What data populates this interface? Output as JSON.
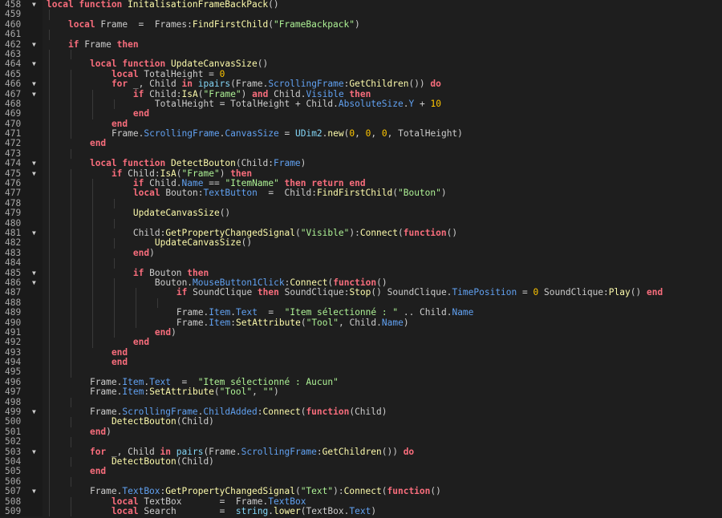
{
  "editor": {
    "language": "lua",
    "colors": {
      "background": "#1e1e1e",
      "gutter": "#1a1a1a",
      "line_number": "#a9a9a9",
      "keyword": "#f86d7c",
      "function": "#fdfbac",
      "property": "#61a1f1",
      "string": "#adf195",
      "number": "#ffc600",
      "builtin": "#84d6f7",
      "text": "#cccccc"
    },
    "lines": [
      {
        "n": "458",
        "fold": true,
        "indent": 0,
        "tokens": [
          [
            "kw",
            "local function "
          ],
          [
            "fn",
            "InitalisationFrameBackPack"
          ],
          [
            "op",
            "()"
          ]
        ]
      },
      {
        "n": "459",
        "fold": false,
        "indent": 1,
        "tokens": []
      },
      {
        "n": "460",
        "fold": false,
        "indent": 1,
        "tokens": [
          [
            "kw",
            "local "
          ],
          [
            "op",
            "Frame  =  Frames:"
          ],
          [
            "fn",
            "FindFirstChild"
          ],
          [
            "op",
            "("
          ],
          [
            "str",
            "\"FrameBackpack\""
          ],
          [
            "op",
            ")"
          ]
        ]
      },
      {
        "n": "461",
        "fold": false,
        "indent": 1,
        "tokens": []
      },
      {
        "n": "462",
        "fold": true,
        "indent": 1,
        "tokens": [
          [
            "kw",
            "if "
          ],
          [
            "op",
            "Frame "
          ],
          [
            "kw",
            "then"
          ]
        ]
      },
      {
        "n": "463",
        "fold": false,
        "indent": 2,
        "tokens": []
      },
      {
        "n": "464",
        "fold": true,
        "indent": 2,
        "tokens": [
          [
            "kw",
            "local function "
          ],
          [
            "fn",
            "UpdateCanvasSize"
          ],
          [
            "op",
            "()"
          ]
        ]
      },
      {
        "n": "465",
        "fold": false,
        "indent": 3,
        "tokens": [
          [
            "kw",
            "local "
          ],
          [
            "op",
            "TotalHeight = "
          ],
          [
            "num",
            "0"
          ]
        ]
      },
      {
        "n": "466",
        "fold": true,
        "indent": 3,
        "tokens": [
          [
            "kw",
            "for "
          ],
          [
            "op",
            "_, Child "
          ],
          [
            "kw",
            "in "
          ],
          [
            "builtin",
            "ipairs"
          ],
          [
            "op",
            "(Frame."
          ],
          [
            "prop",
            "ScrollingFrame"
          ],
          [
            "op",
            ":"
          ],
          [
            "fn",
            "GetChildren"
          ],
          [
            "op",
            "()) "
          ],
          [
            "kw",
            "do"
          ]
        ]
      },
      {
        "n": "467",
        "fold": true,
        "indent": 4,
        "tokens": [
          [
            "kw",
            "if "
          ],
          [
            "op",
            "Child:"
          ],
          [
            "fn",
            "IsA"
          ],
          [
            "op",
            "("
          ],
          [
            "str",
            "\"Frame\""
          ],
          [
            "op",
            ") "
          ],
          [
            "kw",
            "and "
          ],
          [
            "op",
            "Child."
          ],
          [
            "prop",
            "Visible"
          ],
          [
            "kw",
            " then"
          ]
        ]
      },
      {
        "n": "468",
        "fold": false,
        "indent": 5,
        "tokens": [
          [
            "op",
            "TotalHeight = TotalHeight + Child."
          ],
          [
            "prop",
            "AbsoluteSize"
          ],
          [
            "op",
            "."
          ],
          [
            "prop",
            "Y"
          ],
          [
            "op",
            " + "
          ],
          [
            "num",
            "10"
          ]
        ]
      },
      {
        "n": "469",
        "fold": false,
        "indent": 4,
        "tokens": [
          [
            "kw",
            "end"
          ]
        ]
      },
      {
        "n": "470",
        "fold": false,
        "indent": 3,
        "tokens": [
          [
            "kw",
            "end"
          ]
        ]
      },
      {
        "n": "471",
        "fold": false,
        "indent": 3,
        "tokens": [
          [
            "op",
            "Frame."
          ],
          [
            "prop",
            "ScrollingFrame"
          ],
          [
            "op",
            "."
          ],
          [
            "prop",
            "CanvasSize"
          ],
          [
            "op",
            " = "
          ],
          [
            "builtin",
            "UDim2"
          ],
          [
            "op",
            "."
          ],
          [
            "fn",
            "new"
          ],
          [
            "op",
            "("
          ],
          [
            "num",
            "0"
          ],
          [
            "op",
            ", "
          ],
          [
            "num",
            "0"
          ],
          [
            "op",
            ", "
          ],
          [
            "num",
            "0"
          ],
          [
            "op",
            ", TotalHeight)"
          ]
        ]
      },
      {
        "n": "472",
        "fold": false,
        "indent": 2,
        "tokens": [
          [
            "kw",
            "end"
          ]
        ]
      },
      {
        "n": "473",
        "fold": false,
        "indent": 2,
        "tokens": []
      },
      {
        "n": "474",
        "fold": true,
        "indent": 2,
        "tokens": [
          [
            "kw",
            "local function "
          ],
          [
            "fn",
            "DetectBouton"
          ],
          [
            "op",
            "(Child:"
          ],
          [
            "prop",
            "Frame"
          ],
          [
            "op",
            ")"
          ]
        ]
      },
      {
        "n": "475",
        "fold": true,
        "indent": 3,
        "tokens": [
          [
            "kw",
            "if "
          ],
          [
            "op",
            "Child:"
          ],
          [
            "fn",
            "IsA"
          ],
          [
            "op",
            "("
          ],
          [
            "str",
            "\"Frame\""
          ],
          [
            "op",
            ") "
          ],
          [
            "kw",
            "then"
          ]
        ]
      },
      {
        "n": "476",
        "fold": false,
        "indent": 4,
        "tokens": [
          [
            "kw",
            "if "
          ],
          [
            "op",
            "Child."
          ],
          [
            "prop",
            "Name"
          ],
          [
            "op",
            " == "
          ],
          [
            "str",
            "\"ItemName\""
          ],
          [
            "kw",
            " then return end"
          ]
        ]
      },
      {
        "n": "477",
        "fold": false,
        "indent": 4,
        "tokens": [
          [
            "kw",
            "local "
          ],
          [
            "op",
            "Bouton:"
          ],
          [
            "prop",
            "TextButton"
          ],
          [
            "op",
            "  =  Child:"
          ],
          [
            "fn",
            "FindFirstChild"
          ],
          [
            "op",
            "("
          ],
          [
            "str",
            "\"Bouton\""
          ],
          [
            "op",
            ")"
          ]
        ]
      },
      {
        "n": "478",
        "fold": false,
        "indent": 4,
        "tokens": []
      },
      {
        "n": "479",
        "fold": false,
        "indent": 4,
        "tokens": [
          [
            "fn",
            "UpdateCanvasSize"
          ],
          [
            "op",
            "()"
          ]
        ]
      },
      {
        "n": "480",
        "fold": false,
        "indent": 4,
        "tokens": []
      },
      {
        "n": "481",
        "fold": true,
        "indent": 4,
        "tokens": [
          [
            "op",
            "Child:"
          ],
          [
            "fn",
            "GetPropertyChangedSignal"
          ],
          [
            "op",
            "("
          ],
          [
            "str",
            "\"Visible\""
          ],
          [
            "op",
            "):"
          ],
          [
            "fn",
            "Connect"
          ],
          [
            "op",
            "("
          ],
          [
            "kw",
            "function"
          ],
          [
            "op",
            "()"
          ]
        ]
      },
      {
        "n": "482",
        "fold": false,
        "indent": 5,
        "tokens": [
          [
            "fn",
            "UpdateCanvasSize"
          ],
          [
            "op",
            "()"
          ]
        ]
      },
      {
        "n": "483",
        "fold": false,
        "indent": 4,
        "tokens": [
          [
            "kw",
            "end"
          ],
          [
            "op",
            ")"
          ]
        ]
      },
      {
        "n": "484",
        "fold": false,
        "indent": 4,
        "tokens": []
      },
      {
        "n": "485",
        "fold": true,
        "indent": 4,
        "tokens": [
          [
            "kw",
            "if "
          ],
          [
            "op",
            "Bouton "
          ],
          [
            "kw",
            "then"
          ]
        ]
      },
      {
        "n": "486",
        "fold": true,
        "indent": 5,
        "tokens": [
          [
            "op",
            "Bouton."
          ],
          [
            "prop",
            "MouseButton1Click"
          ],
          [
            "op",
            ":"
          ],
          [
            "fn",
            "Connect"
          ],
          [
            "op",
            "("
          ],
          [
            "kw",
            "function"
          ],
          [
            "op",
            "()"
          ]
        ]
      },
      {
        "n": "487",
        "fold": false,
        "indent": 6,
        "tokens": [
          [
            "kw",
            "if "
          ],
          [
            "op",
            "SoundClique "
          ],
          [
            "kw",
            "then "
          ],
          [
            "op",
            "SoundClique:"
          ],
          [
            "fn",
            "Stop"
          ],
          [
            "op",
            "() SoundClique."
          ],
          [
            "prop",
            "TimePosition"
          ],
          [
            "op",
            " = "
          ],
          [
            "num",
            "0"
          ],
          [
            "op",
            " SoundClique:"
          ],
          [
            "fn",
            "Play"
          ],
          [
            "op",
            "() "
          ],
          [
            "kw",
            "end"
          ]
        ]
      },
      {
        "n": "488",
        "fold": false,
        "indent": 6,
        "tokens": []
      },
      {
        "n": "489",
        "fold": false,
        "indent": 6,
        "tokens": [
          [
            "op",
            "Frame."
          ],
          [
            "prop",
            "Item"
          ],
          [
            "op",
            "."
          ],
          [
            "prop",
            "Text"
          ],
          [
            "op",
            "  =  "
          ],
          [
            "str",
            "\"Item sélectionné : \""
          ],
          [
            "op",
            " .. Child."
          ],
          [
            "prop",
            "Name"
          ]
        ]
      },
      {
        "n": "490",
        "fold": false,
        "indent": 6,
        "tokens": [
          [
            "op",
            "Frame."
          ],
          [
            "prop",
            "Item"
          ],
          [
            "op",
            ":"
          ],
          [
            "fn",
            "SetAttribute"
          ],
          [
            "op",
            "("
          ],
          [
            "str",
            "\"Tool\""
          ],
          [
            "op",
            ", Child."
          ],
          [
            "prop",
            "Name"
          ],
          [
            "op",
            ")"
          ]
        ]
      },
      {
        "n": "491",
        "fold": false,
        "indent": 5,
        "tokens": [
          [
            "kw",
            "end"
          ],
          [
            "op",
            ")"
          ]
        ]
      },
      {
        "n": "492",
        "fold": false,
        "indent": 4,
        "tokens": [
          [
            "kw",
            "end"
          ]
        ]
      },
      {
        "n": "493",
        "fold": false,
        "indent": 3,
        "tokens": [
          [
            "kw",
            "end"
          ]
        ]
      },
      {
        "n": "494",
        "fold": false,
        "indent": 3,
        "tokens": [
          [
            "kw",
            "end"
          ]
        ]
      },
      {
        "n": "495",
        "fold": false,
        "indent": 2,
        "tokens": []
      },
      {
        "n": "496",
        "fold": false,
        "indent": 2,
        "tokens": [
          [
            "op",
            "Frame."
          ],
          [
            "prop",
            "Item"
          ],
          [
            "op",
            "."
          ],
          [
            "prop",
            "Text"
          ],
          [
            "op",
            "  =  "
          ],
          [
            "str",
            "\"Item sélectionné : Aucun\""
          ]
        ]
      },
      {
        "n": "497",
        "fold": false,
        "indent": 2,
        "tokens": [
          [
            "op",
            "Frame."
          ],
          [
            "prop",
            "Item"
          ],
          [
            "op",
            ":"
          ],
          [
            "fn",
            "SetAttribute"
          ],
          [
            "op",
            "("
          ],
          [
            "str",
            "\"Tool\""
          ],
          [
            "op",
            ", "
          ],
          [
            "str",
            "\"\""
          ],
          [
            "op",
            ")"
          ]
        ]
      },
      {
        "n": "498",
        "fold": false,
        "indent": 2,
        "tokens": []
      },
      {
        "n": "499",
        "fold": true,
        "indent": 2,
        "tokens": [
          [
            "op",
            "Frame."
          ],
          [
            "prop",
            "ScrollingFrame"
          ],
          [
            "op",
            "."
          ],
          [
            "prop",
            "ChildAdded"
          ],
          [
            "op",
            ":"
          ],
          [
            "fn",
            "Connect"
          ],
          [
            "op",
            "("
          ],
          [
            "kw",
            "function"
          ],
          [
            "op",
            "(Child)"
          ]
        ]
      },
      {
        "n": "500",
        "fold": false,
        "indent": 3,
        "tokens": [
          [
            "fn",
            "DetectBouton"
          ],
          [
            "op",
            "(Child)"
          ]
        ]
      },
      {
        "n": "501",
        "fold": false,
        "indent": 2,
        "tokens": [
          [
            "kw",
            "end"
          ],
          [
            "op",
            ")"
          ]
        ]
      },
      {
        "n": "502",
        "fold": false,
        "indent": 2,
        "tokens": []
      },
      {
        "n": "503",
        "fold": true,
        "indent": 2,
        "tokens": [
          [
            "kw",
            "for "
          ],
          [
            "op",
            "_, Child "
          ],
          [
            "kw",
            "in "
          ],
          [
            "builtin",
            "pairs"
          ],
          [
            "op",
            "(Frame."
          ],
          [
            "prop",
            "ScrollingFrame"
          ],
          [
            "op",
            ":"
          ],
          [
            "fn",
            "GetChildren"
          ],
          [
            "op",
            "()) "
          ],
          [
            "kw",
            "do"
          ]
        ]
      },
      {
        "n": "504",
        "fold": false,
        "indent": 3,
        "tokens": [
          [
            "fn",
            "DetectBouton"
          ],
          [
            "op",
            "(Child)"
          ]
        ]
      },
      {
        "n": "505",
        "fold": false,
        "indent": 2,
        "tokens": [
          [
            "kw",
            "end"
          ]
        ]
      },
      {
        "n": "506",
        "fold": false,
        "indent": 2,
        "tokens": []
      },
      {
        "n": "507",
        "fold": true,
        "indent": 2,
        "tokens": [
          [
            "op",
            "Frame."
          ],
          [
            "prop",
            "TextBox"
          ],
          [
            "op",
            ":"
          ],
          [
            "fn",
            "GetPropertyChangedSignal"
          ],
          [
            "op",
            "("
          ],
          [
            "str",
            "\"Text\""
          ],
          [
            "op",
            "):"
          ],
          [
            "fn",
            "Connect"
          ],
          [
            "op",
            "("
          ],
          [
            "kw",
            "function"
          ],
          [
            "op",
            "()"
          ]
        ]
      },
      {
        "n": "508",
        "fold": false,
        "indent": 3,
        "tokens": [
          [
            "kw",
            "local "
          ],
          [
            "op",
            "TextBox       =  Frame."
          ],
          [
            "prop",
            "TextBox"
          ]
        ]
      },
      {
        "n": "509",
        "fold": false,
        "indent": 3,
        "tokens": [
          [
            "kw",
            "local "
          ],
          [
            "op",
            "Search        =  "
          ],
          [
            "builtin",
            "string"
          ],
          [
            "op",
            "."
          ],
          [
            "fn",
            "lower"
          ],
          [
            "op",
            "(TextBox."
          ],
          [
            "prop",
            "Text"
          ],
          [
            "op",
            ")"
          ]
        ]
      }
    ]
  }
}
